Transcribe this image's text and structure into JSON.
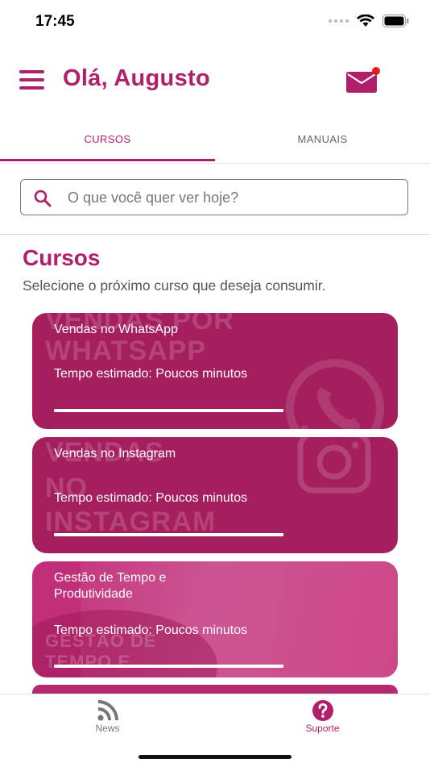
{
  "status_bar": {
    "time": "17:45"
  },
  "header": {
    "greeting": "Olá, Augusto"
  },
  "tabs": [
    {
      "label": "CURSOS",
      "active": true
    },
    {
      "label": "MANUAIS",
      "active": false
    }
  ],
  "search": {
    "placeholder": "O que você quer ver hoje?",
    "value": ""
  },
  "section": {
    "title": "Cursos",
    "subtitle": "Selecione o próximo curso que deseja consumir."
  },
  "courses": [
    {
      "title": "Vendas no WhatsApp",
      "time": "Tempo estimado: Poucos minutos",
      "bg_text": [
        "VENDAS POR",
        "WHATSAPP"
      ],
      "progress": 1.0
    },
    {
      "title": "Vendas no Instagram",
      "time": "Tempo estimado: Poucos minutos",
      "bg_text": [
        "VENDAS",
        "NO",
        "INSTAGRAM"
      ],
      "progress": 1.0
    },
    {
      "title": "Gestão de Tempo e Produtividade",
      "time": "Tempo estimado: Poucos minutos",
      "bg_text": [
        "GESTÃO DE",
        "TEMPO E"
      ],
      "progress": 1.0
    }
  ],
  "bottom_nav": [
    {
      "label": "News",
      "icon": "rss-icon",
      "active": false
    },
    {
      "label": "Suporte",
      "icon": "help-circle-icon",
      "active": true
    }
  ],
  "colors": {
    "brand": "#b0206a",
    "card": "#a51e5e",
    "card_alt": "#c12f7a",
    "badge": "#e02020"
  }
}
